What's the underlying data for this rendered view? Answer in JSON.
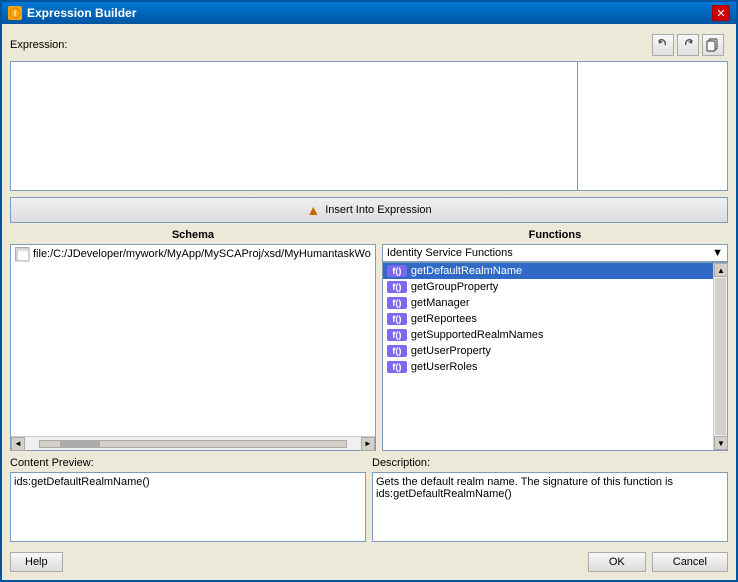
{
  "window": {
    "title": "Expression Builder",
    "icon": "⚙"
  },
  "toolbar": {
    "undo_label": "↩",
    "redo_label": "↪",
    "copy_label": "📋"
  },
  "expression": {
    "label": "Expression:",
    "value": ""
  },
  "insert_button": {
    "label": "Insert Into Expression",
    "arrow": "▲"
  },
  "schema": {
    "header": "Schema",
    "item": "file:/C:/JDeveloper/mywork/MyApp/MySCAProj/xsd/MyHumantaskWo"
  },
  "functions": {
    "header": "Functions",
    "dropdown_label": "Identity Service Functions",
    "items": [
      {
        "badge": "f()",
        "name": "getDefaultRealmName",
        "selected": true
      },
      {
        "badge": "f()",
        "name": "getGroupProperty",
        "selected": false
      },
      {
        "badge": "f()",
        "name": "getManager",
        "selected": false
      },
      {
        "badge": "f()",
        "name": "getReportees",
        "selected": false
      },
      {
        "badge": "f()",
        "name": "getSupportedRealmNames",
        "selected": false
      },
      {
        "badge": "f()",
        "name": "getUserProperty",
        "selected": false
      },
      {
        "badge": "f()",
        "name": "getUserRoles",
        "selected": false
      }
    ]
  },
  "content_preview": {
    "label": "Content Preview:",
    "value": "ids:getDefaultRealmName()"
  },
  "description": {
    "label": "Description:",
    "value": "Gets the default realm name. The signature of this function is ids:getDefaultRealmName()"
  },
  "buttons": {
    "help": "Help",
    "ok": "OK",
    "cancel": "Cancel"
  }
}
